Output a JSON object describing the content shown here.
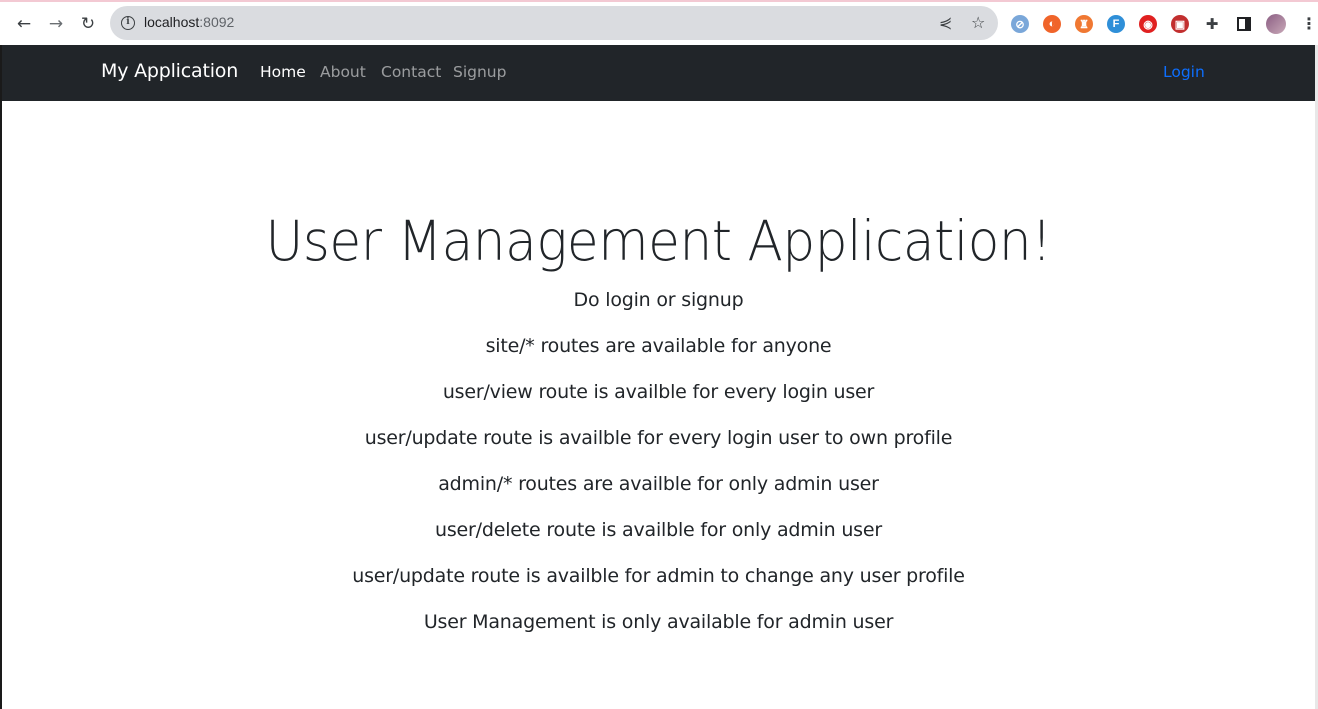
{
  "browser": {
    "url_host": "localhost",
    "url_port": ":8092",
    "back_icon": "arrow-left",
    "forward_icon": "arrow-right",
    "reload_icon": "reload",
    "extensions": [
      {
        "name": "extension-1",
        "color": "#7aa7d9",
        "glyph": "⊘"
      },
      {
        "name": "extension-2",
        "color": "#f0642a",
        "glyph": "◐"
      },
      {
        "name": "extension-3",
        "color": "#f07832",
        "glyph": "♜"
      },
      {
        "name": "extension-4",
        "color": "#2f8fd8",
        "glyph": "F"
      },
      {
        "name": "extension-5",
        "color": "#e02020",
        "glyph": "◉"
      },
      {
        "name": "extension-6",
        "color": "#c22f2f",
        "glyph": "▣"
      }
    ]
  },
  "navbar": {
    "brand": "My Application",
    "links": [
      {
        "label": "Home",
        "active": true
      },
      {
        "label": "About",
        "active": false
      },
      {
        "label": "Contact",
        "active": false
      },
      {
        "label": "Signup",
        "active": false
      }
    ],
    "login": "Login"
  },
  "main": {
    "title": "User Management Application!",
    "lines": [
      "Do login or signup",
      "site/* routes are available for anyone",
      "user/view route is availble for every login user",
      "user/update route is availble for every login user to own profile",
      "admin/* routes are availble for only admin user",
      "user/delete route is availble for only admin user",
      "user/update route is availble for admin to change any user profile",
      "User Management is only available for admin user"
    ]
  },
  "colors": {
    "navbar_bg": "#212529",
    "link_active": "#ffffff",
    "link_muted": "rgba(255,255,255,0.55)",
    "login_link": "#0d6efd",
    "text": "#212529"
  }
}
